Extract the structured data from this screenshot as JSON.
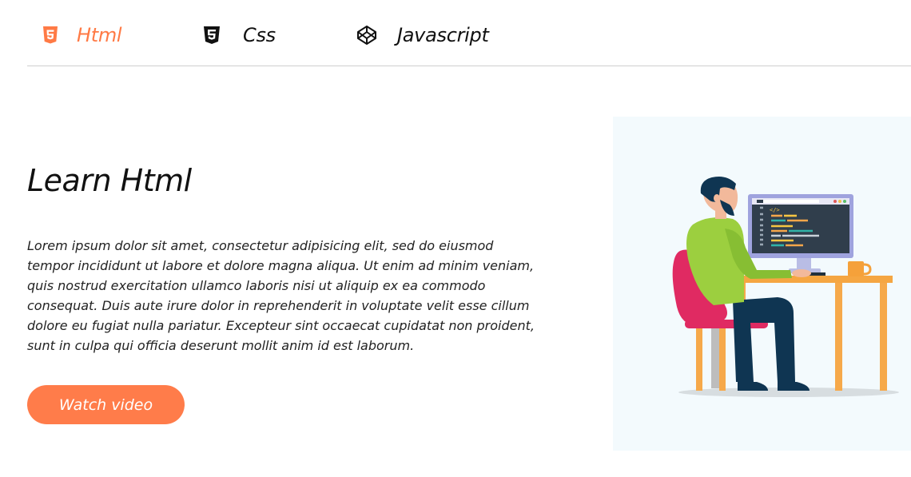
{
  "tabs": [
    {
      "label": "Html",
      "icon": "html5-icon",
      "active": true
    },
    {
      "label": "Css",
      "icon": "css3-icon",
      "active": false
    },
    {
      "label": "Javascript",
      "icon": "codepen-icon",
      "active": false
    }
  ],
  "main": {
    "title": "Learn Html",
    "description": "Lorem ipsum dolor sit amet, consectetur adipisicing elit, sed do eiusmod tempor incididunt ut labore et dolore magna aliqua. Ut enim ad minim veniam, quis nostrud exercitation ullamco laboris nisi ut aliquip ex ea commodo consequat. Duis aute irure dolor in reprehenderit in voluptate velit esse cillum dolore eu fugiat nulla pariatur. Excepteur sint occaecat cupidatat non proident, sunt in culpa qui officia deserunt mollit anim id est laborum.",
    "button_label": "Watch video"
  },
  "colors": {
    "accent": "#ff7c4a",
    "text": "#111111",
    "divider": "#cfcfcf",
    "illustration_bg": "#f3fafd"
  },
  "illustration": {
    "subject": "developer-at-desk-illustration",
    "code_symbol": "</>"
  }
}
